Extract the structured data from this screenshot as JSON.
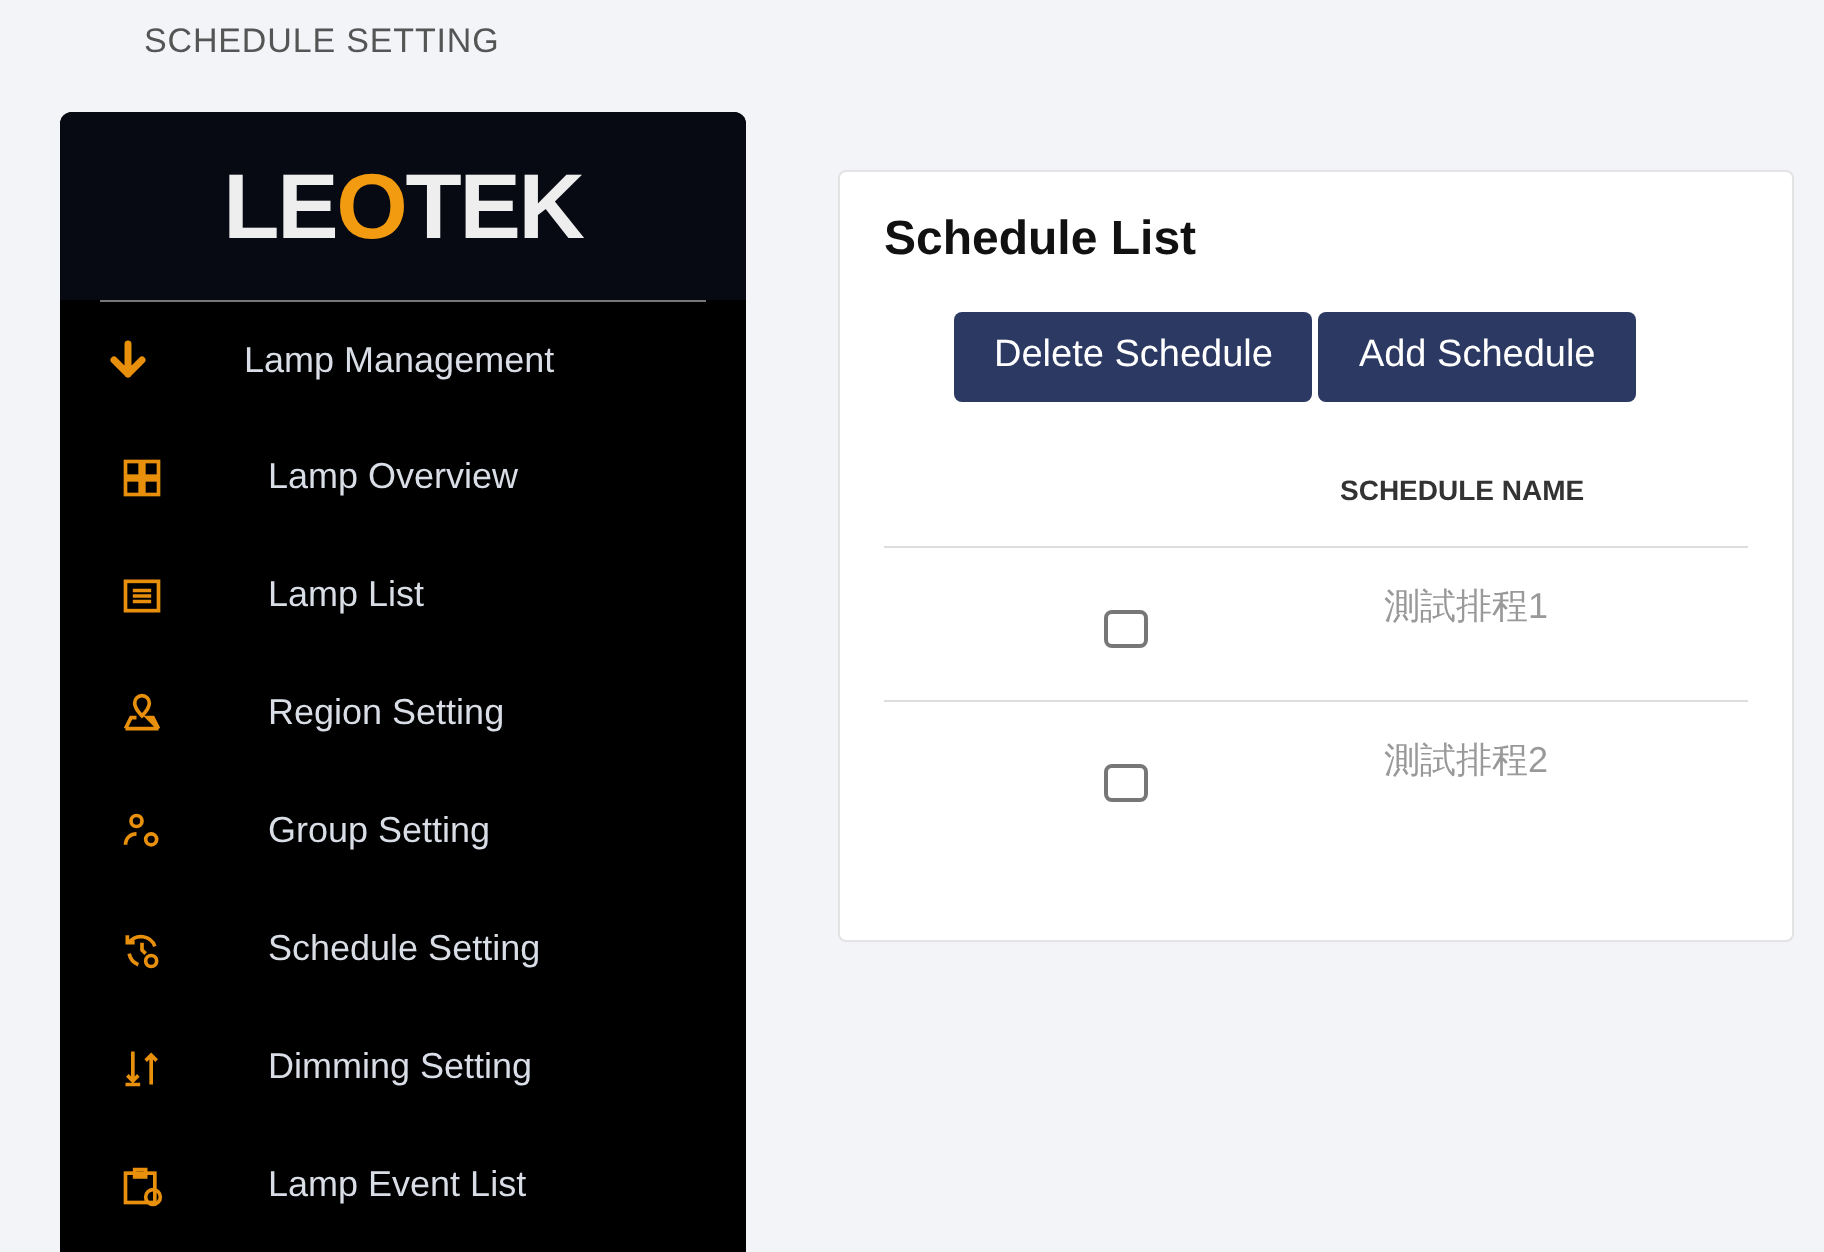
{
  "page_title": "SCHEDULE SETTING",
  "sidebar": {
    "logo": "LEOTEK",
    "section": {
      "label": "Lamp Management",
      "expanded": true
    },
    "items": [
      {
        "label": "Lamp Overview",
        "kind": "grid"
      },
      {
        "label": "Lamp List",
        "kind": "list"
      },
      {
        "label": "Region Setting",
        "kind": "region"
      },
      {
        "label": "Group Setting",
        "kind": "group"
      },
      {
        "label": "Schedule Setting",
        "kind": "schedule"
      },
      {
        "label": "Dimming Setting",
        "kind": "dimming"
      },
      {
        "label": "Lamp Event List",
        "kind": "event"
      }
    ]
  },
  "card": {
    "title": "Schedule List",
    "buttons": [
      "Delete Schedule",
      "Add Schedule"
    ],
    "table": {
      "columns": [
        "SCHEDULE NAME"
      ],
      "rows": [
        {
          "name": "測試排程1",
          "checked": false
        },
        {
          "name": "測試排程2",
          "checked": false
        }
      ]
    }
  }
}
